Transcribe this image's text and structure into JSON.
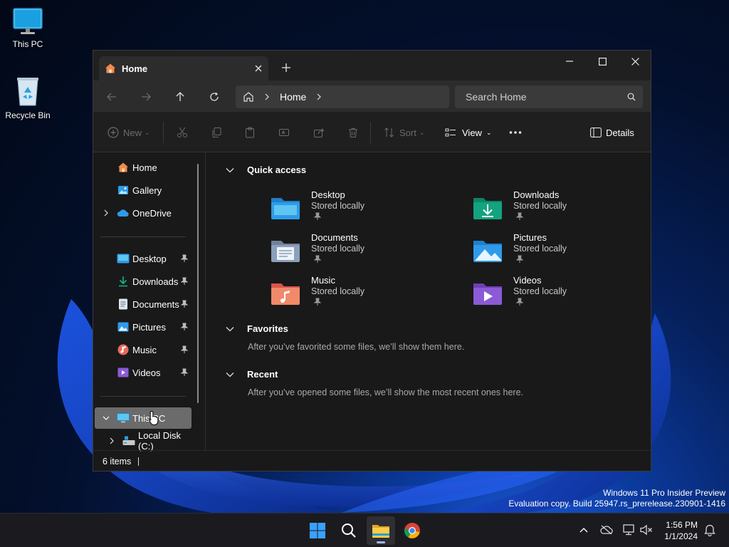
{
  "desktop": {
    "icons": [
      {
        "label": "This PC",
        "icon": "monitor-icon"
      },
      {
        "label": "Recycle Bin",
        "icon": "recycle-bin-icon"
      }
    ]
  },
  "watermark": {
    "line1": "Windows 11 Pro Insider Preview",
    "line2": "Evaluation copy. Build 25947.rs_prerelease.230901-1416"
  },
  "explorer": {
    "tab_title": "Home",
    "address": {
      "crumb": "Home"
    },
    "search": {
      "placeholder": "Search Home"
    },
    "commands": {
      "new": "New",
      "sort": "Sort",
      "view": "View",
      "details": "Details"
    },
    "sidebar": {
      "top": [
        {
          "label": "Home",
          "icon": "home-icon"
        },
        {
          "label": "Gallery",
          "icon": "gallery-icon"
        },
        {
          "label": "OneDrive",
          "icon": "onedrive-icon"
        }
      ],
      "pinned": [
        {
          "label": "Desktop",
          "icon": "desktop-folder-icon"
        },
        {
          "label": "Downloads",
          "icon": "downloads-icon"
        },
        {
          "label": "Documents",
          "icon": "documents-icon"
        },
        {
          "label": "Pictures",
          "icon": "pictures-icon"
        },
        {
          "label": "Music",
          "icon": "music-icon"
        },
        {
          "label": "Videos",
          "icon": "videos-icon"
        }
      ],
      "this_pc": "This PC",
      "local_disk": "Local Disk (C:)"
    },
    "sections": {
      "quick_access": "Quick access",
      "favorites": "Favorites",
      "favorites_msg": "After you’ve favorited some files, we’ll show them here.",
      "recent": "Recent",
      "recent_msg": "After you’ve opened some files, we’ll show the most recent ones here."
    },
    "quick_access": [
      {
        "name": "Desktop",
        "status": "Stored locally",
        "color": "#2f9be8"
      },
      {
        "name": "Downloads",
        "status": "Stored locally",
        "color": "#14a37f"
      },
      {
        "name": "Documents",
        "status": "Stored locally",
        "color": "#8aa0bb"
      },
      {
        "name": "Pictures",
        "status": "Stored locally",
        "color": "#2f9be8"
      },
      {
        "name": "Music",
        "status": "Stored locally",
        "color": "#e8685a"
      },
      {
        "name": "Videos",
        "status": "Stored locally",
        "color": "#8b5bd6"
      }
    ],
    "status": {
      "items": "6 items"
    }
  },
  "taskbar": {
    "time": "1:56 PM",
    "date": "1/1/2024"
  }
}
